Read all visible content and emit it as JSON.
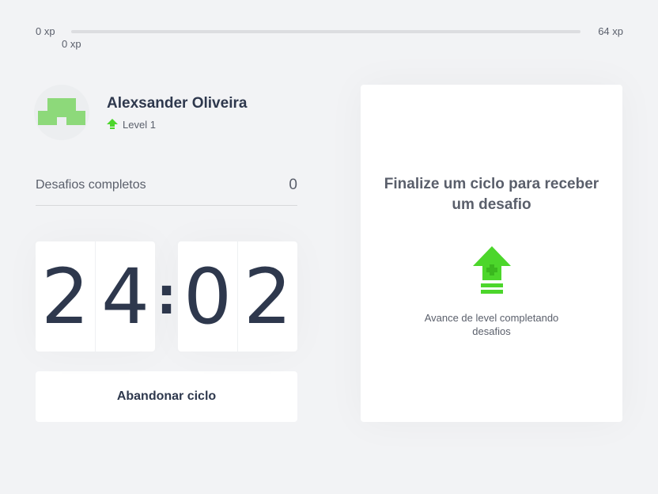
{
  "xp": {
    "min_label": "0 xp",
    "max_label": "64 xp",
    "current_label": "0 xp",
    "progress_fraction": 0
  },
  "profile": {
    "name": "Alexsander Oliveira",
    "level_label": "Level 1",
    "avatar_icon": "pixel-avatar-icon",
    "avatar_color": "#8dd97a"
  },
  "challenges": {
    "label": "Desafios completos",
    "count": "0"
  },
  "countdown": {
    "minutes_left": "2",
    "minutes_right": "4",
    "separator": ":",
    "seconds_left": "0",
    "seconds_right": "2"
  },
  "actions": {
    "abandon_label": "Abandonar ciclo"
  },
  "challenge_card": {
    "title": "Finalize um ciclo para receber um desafio",
    "icon": "level-up-icon",
    "description": "Avance de level completando desafios"
  },
  "colors": {
    "accent_green": "#4cd62b",
    "text_dark": "#2e384d",
    "text_muted": "#5a5f6b",
    "background": "#f2f3f5"
  }
}
